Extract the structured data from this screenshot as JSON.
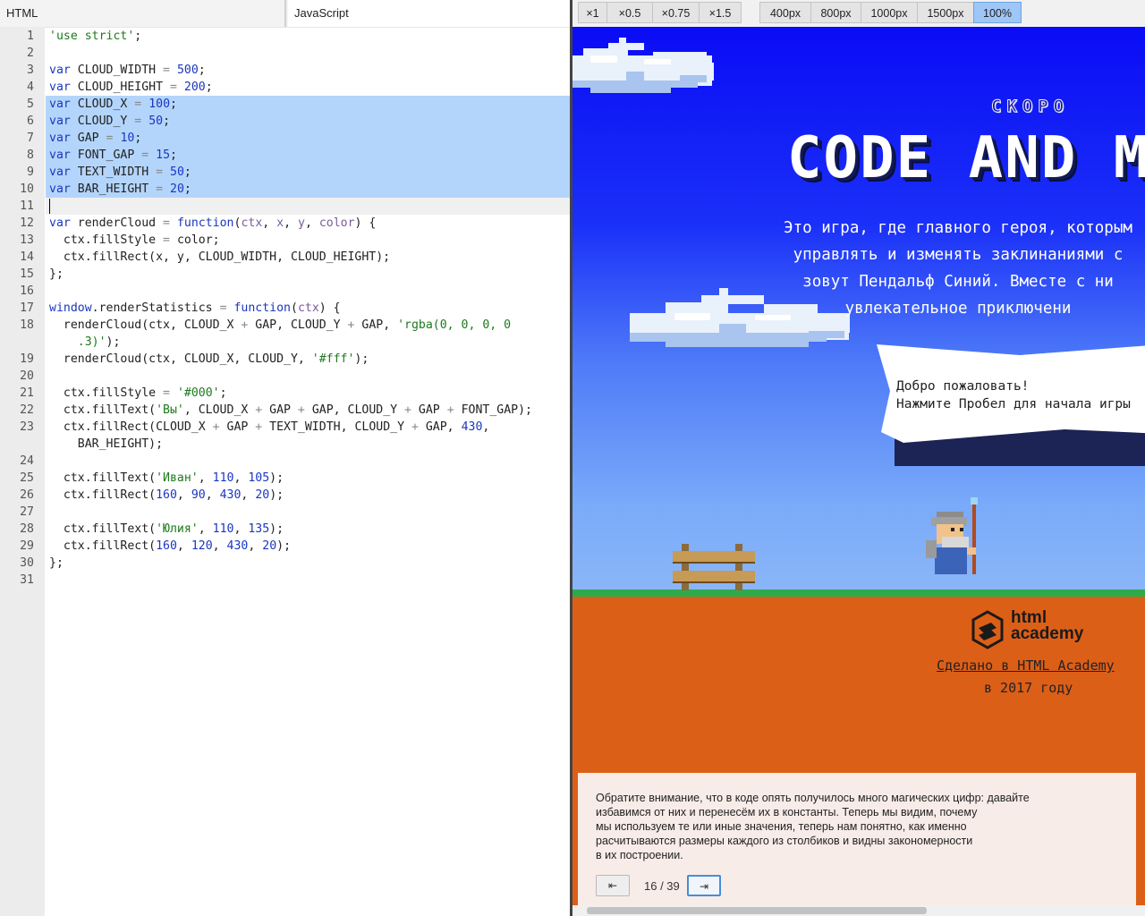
{
  "editor": {
    "tabs": [
      {
        "label": "HTML"
      },
      {
        "label": "JavaScript"
      }
    ],
    "active_tab": "JavaScript",
    "lines": [
      {
        "num": "1",
        "tokens": [
          [
            "s",
            "'use strict'"
          ],
          [
            "",
            "; "
          ]
        ]
      },
      {
        "num": "2",
        "tokens": []
      },
      {
        "num": "3",
        "tokens": [
          [
            "k",
            "var"
          ],
          [
            "",
            " CLOUD_WIDTH "
          ],
          [
            "o",
            "="
          ],
          [
            "",
            " "
          ],
          [
            "n",
            "500"
          ],
          [
            "",
            ";"
          ]
        ]
      },
      {
        "num": "4",
        "tokens": [
          [
            "k",
            "var"
          ],
          [
            "",
            " CLOUD_HEIGHT "
          ],
          [
            "o",
            "="
          ],
          [
            "",
            " "
          ],
          [
            "n",
            "200"
          ],
          [
            "",
            ";"
          ]
        ]
      },
      {
        "num": "5",
        "tokens": [
          [
            "k",
            "var"
          ],
          [
            "",
            " CLOUD_X "
          ],
          [
            "o",
            "="
          ],
          [
            "",
            " "
          ],
          [
            "n",
            "100"
          ],
          [
            "",
            ";"
          ]
        ]
      },
      {
        "num": "6",
        "tokens": [
          [
            "k",
            "var"
          ],
          [
            "",
            " CLOUD_Y "
          ],
          [
            "o",
            "="
          ],
          [
            "",
            " "
          ],
          [
            "n",
            "50"
          ],
          [
            "",
            ";"
          ]
        ]
      },
      {
        "num": "7",
        "tokens": [
          [
            "k",
            "var"
          ],
          [
            "",
            " GAP "
          ],
          [
            "o",
            "="
          ],
          [
            "",
            " "
          ],
          [
            "n",
            "10"
          ],
          [
            "",
            ";"
          ]
        ]
      },
      {
        "num": "8",
        "tokens": [
          [
            "k",
            "var"
          ],
          [
            "",
            " FONT_GAP "
          ],
          [
            "o",
            "="
          ],
          [
            "",
            " "
          ],
          [
            "n",
            "15"
          ],
          [
            "",
            ";"
          ]
        ]
      },
      {
        "num": "9",
        "tokens": [
          [
            "k",
            "var"
          ],
          [
            "",
            " TEXT_WIDTH "
          ],
          [
            "o",
            "="
          ],
          [
            "",
            " "
          ],
          [
            "n",
            "50"
          ],
          [
            "",
            ";"
          ]
        ]
      },
      {
        "num": "10",
        "tokens": [
          [
            "k",
            "var"
          ],
          [
            "",
            " BAR_HEIGHT "
          ],
          [
            "o",
            "="
          ],
          [
            "",
            " "
          ],
          [
            "n",
            "20"
          ],
          [
            "",
            ";"
          ]
        ]
      },
      {
        "num": "11",
        "tokens": []
      },
      {
        "num": "12",
        "tokens": [
          [
            "k",
            "var"
          ],
          [
            "",
            " renderCloud "
          ],
          [
            "o",
            "="
          ],
          [
            "",
            " "
          ],
          [
            "k",
            "function"
          ],
          [
            "",
            "("
          ],
          [
            "p",
            "ctx"
          ],
          [
            "",
            ", "
          ],
          [
            "p",
            "x"
          ],
          [
            "",
            ", "
          ],
          [
            "p",
            "y"
          ],
          [
            "",
            ", "
          ],
          [
            "p",
            "color"
          ],
          [
            "",
            ") {"
          ]
        ]
      },
      {
        "num": "13",
        "tokens": [
          [
            "",
            "  ctx.fillStyle "
          ],
          [
            "o",
            "="
          ],
          [
            "",
            " color;"
          ]
        ]
      },
      {
        "num": "14",
        "tokens": [
          [
            "",
            "  ctx.fillRect(x, y, CLOUD_WIDTH, CLOUD_HEIGHT);"
          ]
        ]
      },
      {
        "num": "15",
        "tokens": [
          [
            "",
            "};"
          ]
        ]
      },
      {
        "num": "16",
        "tokens": []
      },
      {
        "num": "17",
        "tokens": [
          [
            "k",
            "window"
          ],
          [
            "",
            ".renderStatistics "
          ],
          [
            "o",
            "="
          ],
          [
            "",
            " "
          ],
          [
            "k",
            "function"
          ],
          [
            "",
            "("
          ],
          [
            "p",
            "ctx"
          ],
          [
            "",
            ") {"
          ]
        ]
      },
      {
        "num": "18",
        "tokens": [
          [
            "",
            "  renderCloud(ctx, CLOUD_X "
          ],
          [
            "o",
            "+"
          ],
          [
            "",
            " GAP, CLOUD_Y "
          ],
          [
            "o",
            "+"
          ],
          [
            "",
            " GAP, "
          ],
          [
            "s",
            "'rgba(0, 0, 0, 0"
          ]
        ]
      },
      {
        "num": "",
        "tokens": [
          [
            "s",
            "    .3)'"
          ],
          [
            "",
            ");"
          ]
        ]
      },
      {
        "num": "19",
        "tokens": [
          [
            "",
            "  renderCloud(ctx, CLOUD_X, CLOUD_Y, "
          ],
          [
            "s",
            "'#fff'"
          ],
          [
            "",
            ");"
          ]
        ]
      },
      {
        "num": "20",
        "tokens": []
      },
      {
        "num": "21",
        "tokens": [
          [
            "",
            "  ctx.fillStyle "
          ],
          [
            "o",
            "="
          ],
          [
            "",
            " "
          ],
          [
            "s",
            "'#000'"
          ],
          [
            "",
            ";"
          ]
        ]
      },
      {
        "num": "22",
        "tokens": [
          [
            "",
            "  ctx.fillText("
          ],
          [
            "s",
            "'Вы'"
          ],
          [
            "",
            ", CLOUD_X "
          ],
          [
            "o",
            "+"
          ],
          [
            "",
            " GAP "
          ],
          [
            "o",
            "+"
          ],
          [
            "",
            " GAP, CLOUD_Y "
          ],
          [
            "o",
            "+"
          ],
          [
            "",
            " GAP "
          ],
          [
            "o",
            "+"
          ],
          [
            "",
            " FONT_GAP);"
          ]
        ]
      },
      {
        "num": "23",
        "tokens": [
          [
            "",
            "  ctx.fillRect(CLOUD_X "
          ],
          [
            "o",
            "+"
          ],
          [
            "",
            " GAP "
          ],
          [
            "o",
            "+"
          ],
          [
            "",
            " TEXT_WIDTH, CLOUD_Y "
          ],
          [
            "o",
            "+"
          ],
          [
            "",
            " GAP, "
          ],
          [
            "n",
            "430"
          ],
          [
            "",
            ","
          ]
        ]
      },
      {
        "num": "",
        "tokens": [
          [
            "",
            "    BAR_HEIGHT);"
          ]
        ]
      },
      {
        "num": "24",
        "tokens": []
      },
      {
        "num": "25",
        "tokens": [
          [
            "",
            "  ctx.fillText("
          ],
          [
            "s",
            "'Иван'"
          ],
          [
            "",
            ", "
          ],
          [
            "n",
            "110"
          ],
          [
            "",
            ", "
          ],
          [
            "n",
            "105"
          ],
          [
            "",
            ");"
          ]
        ]
      },
      {
        "num": "26",
        "tokens": [
          [
            "",
            "  ctx.fillRect("
          ],
          [
            "n",
            "160"
          ],
          [
            "",
            ", "
          ],
          [
            "n",
            "90"
          ],
          [
            "",
            ", "
          ],
          [
            "n",
            "430"
          ],
          [
            "",
            ", "
          ],
          [
            "n",
            "20"
          ],
          [
            "",
            ");"
          ]
        ]
      },
      {
        "num": "27",
        "tokens": []
      },
      {
        "num": "28",
        "tokens": [
          [
            "",
            "  ctx.fillText("
          ],
          [
            "s",
            "'Юлия'"
          ],
          [
            "",
            ", "
          ],
          [
            "n",
            "110"
          ],
          [
            "",
            ", "
          ],
          [
            "n",
            "135"
          ],
          [
            "",
            ");"
          ]
        ]
      },
      {
        "num": "29",
        "tokens": [
          [
            "",
            "  ctx.fillRect("
          ],
          [
            "n",
            "160"
          ],
          [
            "",
            ", "
          ],
          [
            "n",
            "120"
          ],
          [
            "",
            ", "
          ],
          [
            "n",
            "430"
          ],
          [
            "",
            ", "
          ],
          [
            "n",
            "20"
          ],
          [
            "",
            ");"
          ]
        ]
      },
      {
        "num": "30",
        "tokens": [
          [
            "",
            "};"
          ]
        ]
      },
      {
        "num": "31",
        "tokens": []
      }
    ],
    "selected_lines": [
      "5",
      "6",
      "7",
      "8",
      "9",
      "10"
    ],
    "cursor_line": "11"
  },
  "preview": {
    "scale_buttons": [
      "×1",
      "×0.5",
      "×0.75",
      "×1.5"
    ],
    "width_buttons": [
      "400px",
      "800px",
      "1000px",
      "1500px",
      "100%"
    ],
    "active_width": "100%",
    "game": {
      "soon": "СКОРО",
      "title": "CODE AND MAGICK",
      "intro": "Это игра, где главного героя, которым\nуправлять и изменять заклинаниями с\nзовут Пендальф Синий. Вместе с ни\nувлекательное приключени",
      "speech": "Добро пожаловать!\nНажмите Пробел для начала игры",
      "logo_text": "html\nacademy",
      "made_by": "Сделано в HTML Academy",
      "year": "в 2017 году"
    },
    "note": {
      "text": "Обратите внимание, что в коде опять получилось много магических цифр: давайте\nизбавимся от них и перенесём их в константы. Теперь мы видим, почему\nмы используем те или иные значения, теперь нам понятно, как именно\nрасчитываются размеры каждого из столбиков и видны закономерности\nв их построении.",
      "page": "16 / 39",
      "prev_icon": "⇤",
      "next_icon": "⇥"
    }
  }
}
